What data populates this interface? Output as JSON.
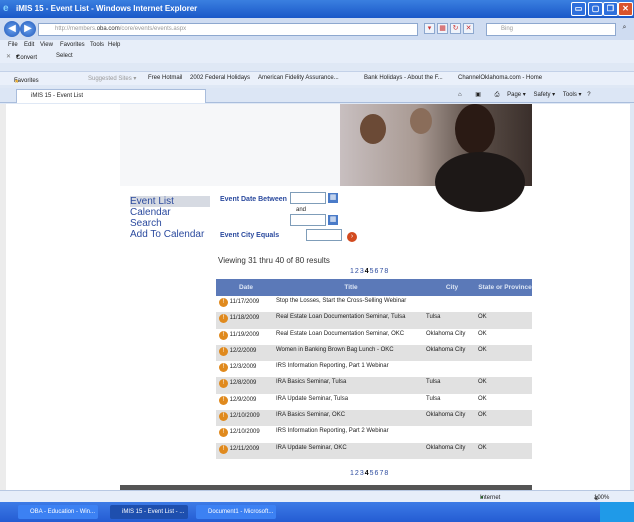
{
  "window": {
    "title": "iMIS 15 - Event List - Windows Internet Explorer",
    "controls": {
      "min": "▭",
      "max": "▢",
      "restore": "❐",
      "close": "✕"
    }
  },
  "address": {
    "prefix": "http://members.",
    "domain": "oba.com",
    "path": "/core/events/events.aspx",
    "search_placeholder": "Bing"
  },
  "menu": [
    "File",
    "Edit",
    "View",
    "Favorites",
    "Tools",
    "Help"
  ],
  "cmdbar": {
    "convert": "Convert",
    "select": "Select"
  },
  "favorites": {
    "label": "Favorites",
    "items": [
      "Suggested Sites ▾",
      "Free Hotmail",
      "2002 Federal Holidays",
      "American Fidelity Assurance...",
      "Bank Holidays - About the F...",
      "ChannelOklahoma.com - Home"
    ]
  },
  "tab": {
    "label": "iMIS 15 - Event List"
  },
  "tabtools": {
    "page": "Page ▾",
    "safety": "Safety ▾",
    "tools": "Tools ▾"
  },
  "sidebar": [
    "Event List",
    "Calendar",
    "Search",
    "Add To Calendar"
  ],
  "filters": {
    "date_label": "Event Date Between",
    "and": "and",
    "city_label": "Event City Equals"
  },
  "results": {
    "text": "Viewing 31 thru 40 of 80 results"
  },
  "pager": {
    "pages": [
      "1",
      "2",
      "3",
      "4",
      "5",
      "6",
      "7",
      "8"
    ],
    "current": "4"
  },
  "table": {
    "headers": [
      "Date",
      "Title",
      "City",
      "State or Province"
    ],
    "rows": [
      {
        "date": "11/17/2009",
        "title": "Stop the Losses, Start the Cross-Selling Webinar",
        "city": "",
        "state": ""
      },
      {
        "date": "11/18/2009",
        "title": "Real Estate Loan Documentation Seminar, Tulsa",
        "city": "Tulsa",
        "state": "OK"
      },
      {
        "date": "11/19/2009",
        "title": "Real Estate Loan Documentation Seminar, OKC",
        "city": "Oklahoma City",
        "state": "OK"
      },
      {
        "date": "12/2/2009",
        "title": "Women in Banking Brown Bag Lunch - OKC",
        "city": "Oklahoma City",
        "state": "OK"
      },
      {
        "date": "12/3/2009",
        "title": "IRS Information Reporting, Part 1 Webinar",
        "city": "",
        "state": ""
      },
      {
        "date": "12/8/2009",
        "title": "IRA Basics Seminar, Tulsa",
        "city": "Tulsa",
        "state": "OK"
      },
      {
        "date": "12/9/2009",
        "title": "IRA Update Seminar, Tulsa",
        "city": "Tulsa",
        "state": "OK"
      },
      {
        "date": "12/10/2009",
        "title": "IRA Basics Seminar, OKC",
        "city": "Oklahoma City",
        "state": "OK"
      },
      {
        "date": "12/10/2009",
        "title": "IRS Information Reporting, Part 2 Webinar",
        "city": "",
        "state": ""
      },
      {
        "date": "12/11/2009",
        "title": "IRA Update Seminar, OKC",
        "city": "Oklahoma City",
        "state": "OK"
      }
    ]
  },
  "status": {
    "zone": "Internet",
    "zoom": "100%"
  },
  "taskbar": [
    "OBA - Education - Win...",
    "iMIS 15 - Event List - ...",
    "Document1 - Microsoft..."
  ]
}
